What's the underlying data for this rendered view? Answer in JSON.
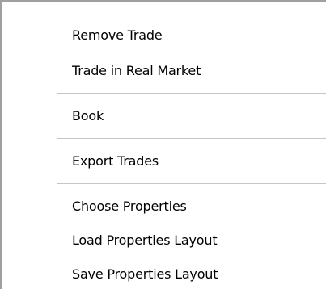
{
  "context_menu": {
    "items": [
      {
        "label": "Remove Trade"
      },
      {
        "label": "Trade in Real Market"
      },
      {
        "label": "Book"
      },
      {
        "label": "Export Trades"
      },
      {
        "label": "Choose Properties"
      },
      {
        "label": "Load Properties Layout"
      },
      {
        "label": "Save Properties Layout"
      }
    ]
  }
}
